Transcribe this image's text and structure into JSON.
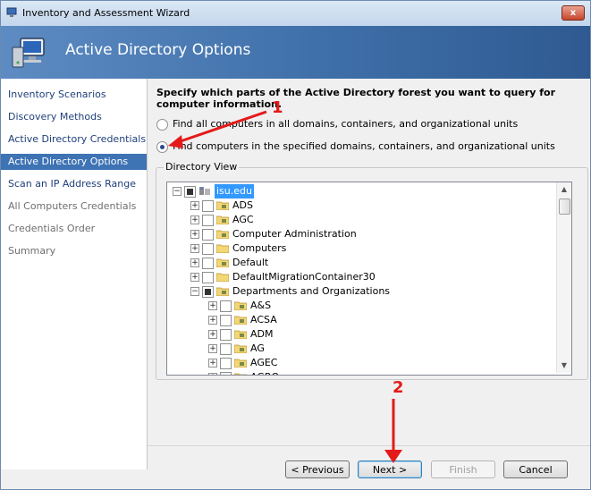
{
  "window": {
    "title": "Inventory and Assessment Wizard",
    "close_glyph": "x"
  },
  "header": {
    "title": "Active Directory Options",
    "icon": "computer-network-icon"
  },
  "sidebar": {
    "items": [
      {
        "label": "Inventory Scenarios",
        "state": "normal"
      },
      {
        "label": "Discovery Methods",
        "state": "normal"
      },
      {
        "label": "Active Directory Credentials",
        "state": "normal"
      },
      {
        "label": "Active Directory Options",
        "state": "selected"
      },
      {
        "label": "Scan an IP Address Range",
        "state": "normal"
      },
      {
        "label": "All Computers Credentials",
        "state": "disabled"
      },
      {
        "label": "Credentials Order",
        "state": "disabled"
      },
      {
        "label": "Summary",
        "state": "disabled"
      }
    ]
  },
  "main": {
    "prompt": "Specify which parts of the Active Directory forest you want to query for computer information.",
    "options": [
      {
        "label": "Find all computers in all domains, containers, and organizational units",
        "checked": false
      },
      {
        "label": "Find computers in the specified domains, containers, and organizational units",
        "checked": true
      }
    ],
    "group_label": "Directory View",
    "tree": [
      {
        "label": "isu.edu",
        "level": 0,
        "selected": true,
        "check": "partial",
        "icon": "domain-icon"
      },
      {
        "label": "ADS",
        "level": 1,
        "check": "none",
        "icon": "ou-folder-icon"
      },
      {
        "label": "AGC",
        "level": 1,
        "check": "none",
        "icon": "ou-folder-icon"
      },
      {
        "label": "Computer Administration",
        "level": 1,
        "check": "none",
        "icon": "ou-folder-icon"
      },
      {
        "label": "Computers",
        "level": 1,
        "check": "none",
        "icon": "folder-icon"
      },
      {
        "label": "Default",
        "level": 1,
        "check": "none",
        "icon": "ou-folder-icon"
      },
      {
        "label": "DefaultMigrationContainer30",
        "level": 1,
        "check": "none",
        "icon": "folder-icon"
      },
      {
        "label": "Departments and Organizations",
        "level": 1,
        "check": "partial",
        "icon": "ou-folder-icon",
        "expanded": true
      },
      {
        "label": "A&S",
        "level": 2,
        "check": "none",
        "icon": "ou-folder-icon"
      },
      {
        "label": "ACSA",
        "level": 2,
        "check": "none",
        "icon": "ou-folder-icon"
      },
      {
        "label": "ADM",
        "level": 2,
        "check": "none",
        "icon": "ou-folder-icon"
      },
      {
        "label": "AG",
        "level": 2,
        "check": "none",
        "icon": "ou-folder-icon"
      },
      {
        "label": "AGEC",
        "level": 2,
        "check": "none",
        "icon": "ou-folder-icon"
      },
      {
        "label": "AGRO",
        "level": 2,
        "check": "none",
        "icon": "ou-folder-icon"
      }
    ]
  },
  "buttons": {
    "previous": "< Previous",
    "next": "Next >",
    "finish": "Finish",
    "cancel": "Cancel"
  },
  "annotations": {
    "marker_1": "1",
    "marker_2": "2",
    "color": "#e41a1a"
  }
}
